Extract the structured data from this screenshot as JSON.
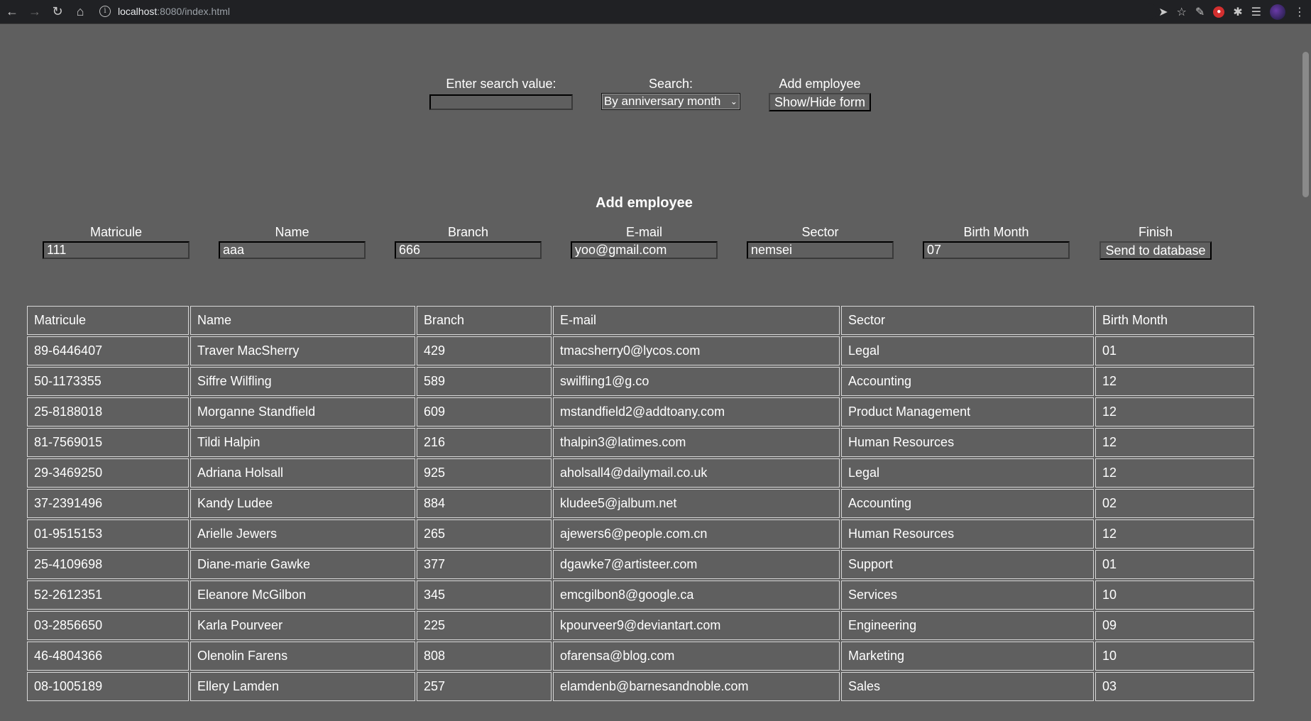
{
  "browser": {
    "url_host": "localhost",
    "url_path": ":8080/index.html"
  },
  "search": {
    "label": "Enter search value:",
    "value": "",
    "mode_label": "Search:",
    "mode_selected": "By anniversary month"
  },
  "add_toggle": {
    "label": "Add employee",
    "button": "Show/Hide form"
  },
  "form": {
    "title": "Add employee",
    "fields": [
      {
        "label": "Matricule",
        "value": "111"
      },
      {
        "label": "Name",
        "value": "aaa"
      },
      {
        "label": "Branch",
        "value": "666"
      },
      {
        "label": "E-mail",
        "value": "yoo@gmail.com"
      },
      {
        "label": "Sector",
        "value": "nemsei"
      },
      {
        "label": "Birth Month",
        "value": "07"
      }
    ],
    "finish_label": "Finish",
    "submit": "Send to database"
  },
  "table": {
    "headers": [
      "Matricule",
      "Name",
      "Branch",
      "E-mail",
      "Sector",
      "Birth Month"
    ],
    "rows": [
      [
        "89-6446407",
        "Traver MacSherry",
        "429",
        "tmacsherry0@lycos.com",
        "Legal",
        "01"
      ],
      [
        "50-1173355",
        "Siffre Wilfling",
        "589",
        "swilfling1@g.co",
        "Accounting",
        "12"
      ],
      [
        "25-8188018",
        "Morganne Standfield",
        "609",
        "mstandfield2@addtoany.com",
        "Product Management",
        "12"
      ],
      [
        "81-7569015",
        "Tildi Halpin",
        "216",
        "thalpin3@latimes.com",
        "Human Resources",
        "12"
      ],
      [
        "29-3469250",
        "Adriana Holsall",
        "925",
        "aholsall4@dailymail.co.uk",
        "Legal",
        "12"
      ],
      [
        "37-2391496",
        "Kandy Ludee",
        "884",
        "kludee5@jalbum.net",
        "Accounting",
        "02"
      ],
      [
        "01-9515153",
        "Arielle Jewers",
        "265",
        "ajewers6@people.com.cn",
        "Human Resources",
        "12"
      ],
      [
        "25-4109698",
        "Diane-marie Gawke",
        "377",
        "dgawke7@artisteer.com",
        "Support",
        "01"
      ],
      [
        "52-2612351",
        "Eleanore McGilbon",
        "345",
        "emcgilbon8@google.ca",
        "Services",
        "10"
      ],
      [
        "03-2856650",
        "Karla Pourveer",
        "225",
        "kpourveer9@deviantart.com",
        "Engineering",
        "09"
      ],
      [
        "46-4804366",
        "Olenolin Farens",
        "808",
        "ofarensa@blog.com",
        "Marketing",
        "10"
      ],
      [
        "08-1005189",
        "Ellery Lamden",
        "257",
        "elamdenb@barnesandnoble.com",
        "Sales",
        "03"
      ]
    ]
  }
}
